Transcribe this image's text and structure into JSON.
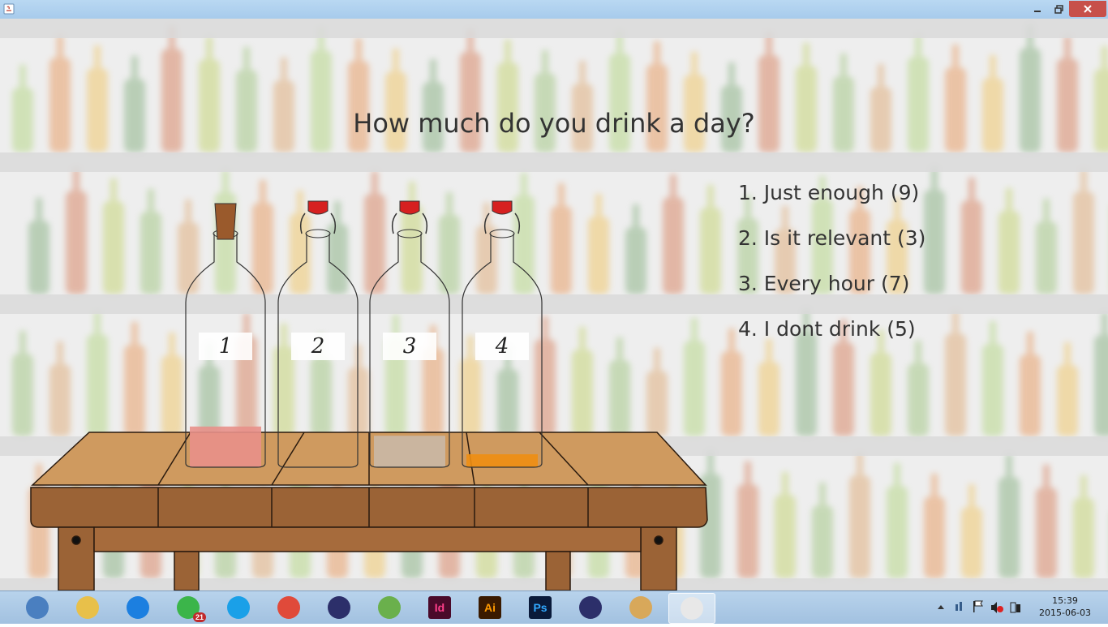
{
  "window": {
    "title": "",
    "controls": [
      "minimize-icon",
      "restore-icon",
      "close-icon"
    ]
  },
  "survey": {
    "question": "How much do you drink a day?",
    "options": [
      {
        "label": "1. Just enough (9)",
        "count": 9
      },
      {
        "label": "2. Is it relevant (3)",
        "count": 3
      },
      {
        "label": "3. Every hour (7)",
        "count": 7
      },
      {
        "label": "4. I dont drink  (5)",
        "count": 5
      }
    ],
    "bottles": [
      {
        "label": "1",
        "stopper": "cork",
        "liquid_color": "#e8908a",
        "fill_fraction": 0.22
      },
      {
        "label": "2",
        "stopper": "swing-top",
        "liquid_color": "#ffffff",
        "fill_fraction": 0.0
      },
      {
        "label": "3",
        "stopper": "swing-top",
        "liquid_color": "#c9b8a6",
        "fill_fraction": 0.17
      },
      {
        "label": "4",
        "stopper": "swing-top",
        "liquid_color": "#ee8e12",
        "fill_fraction": 0.07
      }
    ]
  },
  "taskbar": {
    "apps": [
      {
        "name": "control-panel-icon"
      },
      {
        "name": "file-explorer-icon"
      },
      {
        "name": "dropbox-icon"
      },
      {
        "name": "spotify-icon",
        "badge": "21"
      },
      {
        "name": "skype-icon"
      },
      {
        "name": "chrome-icon"
      },
      {
        "name": "eclipse-icon"
      },
      {
        "name": "android-studio-icon"
      },
      {
        "name": "indesign-icon",
        "text": "Id"
      },
      {
        "name": "illustrator-icon",
        "text": "Ai"
      },
      {
        "name": "photoshop-icon",
        "text": "Ps"
      },
      {
        "name": "eclipse-icon"
      },
      {
        "name": "paint-icon"
      },
      {
        "name": "java-icon"
      }
    ],
    "clock": {
      "time": "15:39",
      "date": "2015-06-03"
    }
  }
}
